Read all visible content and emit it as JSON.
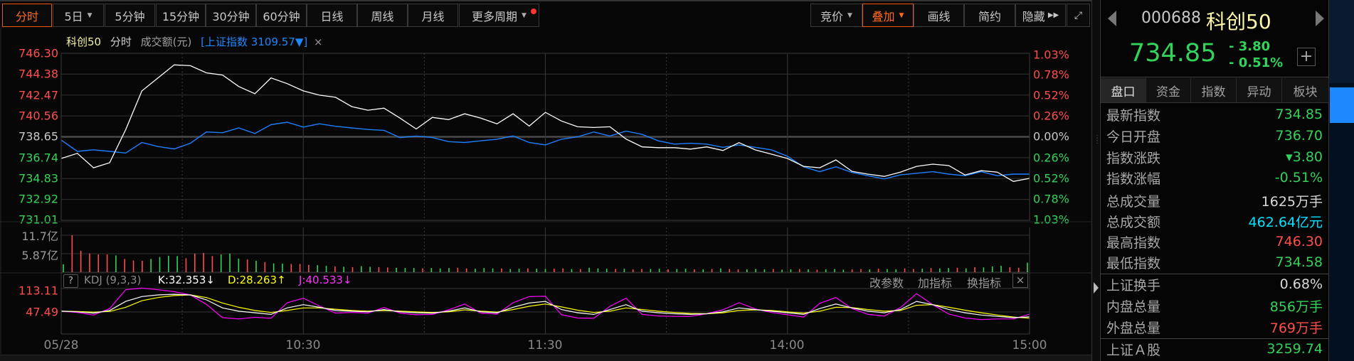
{
  "toolbar": {
    "periods": [
      "分时",
      "5日",
      "5分钟",
      "15分钟",
      "30分钟",
      "60分钟",
      "日线",
      "周线",
      "月线",
      "更多周期"
    ],
    "right": [
      "竞价",
      "叠加",
      "画线",
      "简约",
      "隐藏"
    ]
  },
  "legend": {
    "name": "科创50",
    "mode": "分时",
    "metric": "成交额(元)",
    "overlay": "[上证指数 3109.57▼]",
    "close": "×"
  },
  "price_axis": [
    "746.30",
    "744.38",
    "742.47",
    "740.56",
    "738.65",
    "736.74",
    "734.83",
    "732.92",
    "731.01"
  ],
  "pct_axis": [
    "1.03%",
    "0.78%",
    "0.52%",
    "0.26%",
    "0.00%",
    "0.26%",
    "0.52%",
    "0.78%",
    "1.03%"
  ],
  "volume_axis": [
    "11.7亿",
    "5.87亿"
  ],
  "kdj": {
    "help": "?",
    "title": "KDJ (9,3,3)",
    "k": "K:32.353↓",
    "d": "D:28.263↑",
    "j": "J:40.533↓",
    "actions": [
      "改参数",
      "加指标",
      "换指标"
    ],
    "close": "×",
    "axis": [
      "113.11",
      "47.49"
    ]
  },
  "x_axis": [
    "05/28",
    "10:30",
    "11:30",
    "14:00",
    "15:00"
  ],
  "colors": {
    "up": "#ff4d4d",
    "down": "#33d35a",
    "price_line": "#ffffff",
    "overlay_line": "#1e7fff",
    "k": "#ffffff",
    "d": "#ffff00",
    "j": "#ff00ff",
    "accent": "#ff6a1a"
  },
  "chart_data": {
    "type": "line",
    "title": "科创50 分时",
    "x_range": [
      "09:30",
      "15:00"
    ],
    "sample_interval_minutes": 4,
    "ylim": [
      731.01,
      746.3
    ],
    "prev_close": 738.65,
    "series": [
      {
        "name": "科创50",
        "unit": "price",
        "values": [
          736.67,
          737.14,
          735.82,
          736.28,
          739.31,
          742.86,
          744.05,
          745.24,
          745.17,
          744.51,
          744.31,
          743.26,
          742.6,
          744.05,
          743.52,
          742.86,
          742.47,
          742.27,
          741.42,
          741.09,
          741.28,
          740.36,
          739.37,
          740.43,
          740.23,
          740.76,
          740.36,
          739.84,
          740.76,
          739.64,
          740.89,
          740.1,
          739.57,
          739.51,
          739.57,
          738.45,
          737.73,
          737.66,
          737.66,
          737.53,
          737.73,
          737.4,
          738.12,
          737.46,
          737.07,
          736.67,
          735.95,
          735.82,
          736.54,
          735.49,
          735.23,
          735.03,
          735.42,
          735.95,
          736.15,
          736.02,
          735.16,
          735.55,
          735.42,
          734.57,
          734.85
        ]
      },
      {
        "name": "上证指数",
        "unit": "percent",
        "values": [
          -0.04,
          -0.18,
          -0.16,
          -0.18,
          -0.2,
          -0.07,
          -0.12,
          -0.15,
          -0.08,
          0.06,
          0.05,
          0.11,
          0.04,
          0.15,
          0.18,
          0.12,
          0.16,
          0.13,
          0.11,
          0.09,
          0.08,
          -0.01,
          0.01,
          -0.01,
          -0.06,
          -0.07,
          -0.05,
          -0.03,
          0.01,
          -0.07,
          -0.1,
          -0.03,
          0.0,
          0.06,
          0.01,
          0.07,
          0.03,
          -0.05,
          -0.09,
          -0.08,
          -0.09,
          -0.13,
          -0.1,
          -0.13,
          -0.16,
          -0.24,
          -0.37,
          -0.43,
          -0.37,
          -0.44,
          -0.48,
          -0.52,
          -0.47,
          -0.45,
          -0.43,
          -0.46,
          -0.48,
          -0.43,
          -0.48,
          -0.46,
          -0.46
        ]
      }
    ],
    "volume": {
      "unit": "亿",
      "sample_interval_minutes": 2,
      "values": [
        2.5,
        11.7,
        6.8,
        5.9,
        5.6,
        5.6,
        5.3,
        4.2,
        3.7,
        3.6,
        4.2,
        4.8,
        5.2,
        5.1,
        4.4,
        5.9,
        6.1,
        5.1,
        5.6,
        5.9,
        4.3,
        4.0,
        3.6,
        3.2,
        2.8,
        2.7,
        2.6,
        2.6,
        2.3,
        2.2,
        2.0,
        1.8,
        1.7,
        1.6,
        1.9,
        1.7,
        1.6,
        1.5,
        1.4,
        1.3,
        1.3,
        1.2,
        1.3,
        1.2,
        1.3,
        1.4,
        1.2,
        1.1,
        1.3,
        1.2,
        1.2,
        1.0,
        1.1,
        1.2,
        1.1,
        1.0,
        1.1,
        1.2,
        1.0,
        1.0,
        1.4,
        1.2,
        1.1,
        1.0,
        1.1,
        0.9,
        1.0,
        1.0,
        1.1,
        0.9,
        1.0,
        1.1,
        0.9,
        0.9,
        1.0,
        1.2,
        1.0,
        0.9,
        0.9,
        1.0,
        0.9,
        1.0,
        0.8,
        0.9,
        1.0,
        0.9,
        0.8,
        0.9,
        1.0,
        0.8,
        0.9,
        1.0,
        0.9,
        1.1,
        1.0,
        0.9,
        1.2,
        1.0,
        1.1,
        1.3,
        1.2,
        1.3,
        1.4,
        1.2,
        1.6,
        1.5,
        1.8,
        2.0,
        1.6,
        1.4,
        3.0
      ],
      "direction": "grrrrrgrrrggggrrrrgggrgrggrrrggrgrggrrgggrgggrrgggrggrggrrgrgggrgrrggrggrgrgrrgggrggrgrgggrrgrggrrgrggrgrgggrrggrgrgrrggg",
      "max": 11.7
    },
    "kdj": {
      "ylim": [
        -15,
        125
      ],
      "K": [
        50,
        48,
        44,
        52,
        80,
        95,
        100,
        102,
        100,
        85,
        60,
        50,
        45,
        40,
        60,
        70,
        62,
        52,
        50,
        48,
        55,
        48,
        45,
        44,
        50,
        60,
        48,
        45,
        62,
        75,
        80,
        55,
        45,
        40,
        55,
        70,
        50,
        45,
        42,
        40,
        42,
        48,
        60,
        55,
        50,
        45,
        40,
        58,
        72,
        60,
        50,
        45,
        55,
        80,
        70,
        55,
        45,
        38,
        34,
        30,
        32.353
      ],
      "D": [
        50,
        49,
        47,
        49,
        62,
        82,
        92,
        98,
        100,
        92,
        75,
        62,
        52,
        46,
        52,
        60,
        60,
        56,
        52,
        50,
        52,
        50,
        48,
        46,
        48,
        54,
        50,
        47,
        55,
        65,
        72,
        63,
        53,
        46,
        50,
        60,
        55,
        50,
        46,
        43,
        42,
        45,
        52,
        54,
        52,
        48,
        44,
        50,
        62,
        61,
        55,
        50,
        52,
        68,
        70,
        62,
        53,
        45,
        38,
        32,
        28.263
      ],
      "J": [
        50,
        46,
        38,
        58,
        116,
        121,
        116,
        110,
        100,
        71,
        30,
        26,
        31,
        28,
        76,
        90,
        66,
        44,
        46,
        44,
        61,
        44,
        39,
        40,
        54,
        72,
        44,
        41,
        76,
        95,
        96,
        39,
        29,
        28,
        65,
        90,
        40,
        35,
        34,
        34,
        42,
        54,
        76,
        57,
        46,
        39,
        32,
        74,
        92,
        58,
        40,
        35,
        61,
        104,
        70,
        41,
        29,
        24,
        26,
        26,
        40.533
      ]
    }
  },
  "quote": {
    "code": "000688",
    "name": "科创50",
    "price": "734.85",
    "change": "- 3.80",
    "change_pct": "- 0.51%",
    "plus": "+",
    "tabs": [
      "盘口",
      "资金",
      "指数",
      "异动",
      "板块"
    ],
    "rows": [
      {
        "label": "最新指数",
        "value": "734.85",
        "tone": "dn"
      },
      {
        "label": "今日开盘",
        "value": "736.70",
        "tone": "dn"
      },
      {
        "label": "指数涨跌",
        "value": "▾3.80",
        "tone": "dn"
      },
      {
        "label": "指数涨幅",
        "value": "-0.51%",
        "tone": "dn"
      },
      {
        "label": "总成交量",
        "value": "1625万手",
        "tone": "flat"
      },
      {
        "label": "总成交额",
        "value": "462.64亿元",
        "tone": "cyan"
      },
      {
        "label": "最高指数",
        "value": "746.30",
        "tone": "up"
      },
      {
        "label": "最低指数",
        "value": "734.58",
        "tone": "dn"
      },
      {
        "label": "上证换手",
        "value": "0.68%",
        "tone": "flat"
      },
      {
        "label": "内盘总量",
        "value": "856万手",
        "tone": "dn"
      },
      {
        "label": "外盘总量",
        "value": "769万手",
        "tone": "up"
      },
      {
        "label": "上证Ａ股",
        "value": "3259.74",
        "tone": "dn"
      }
    ]
  }
}
